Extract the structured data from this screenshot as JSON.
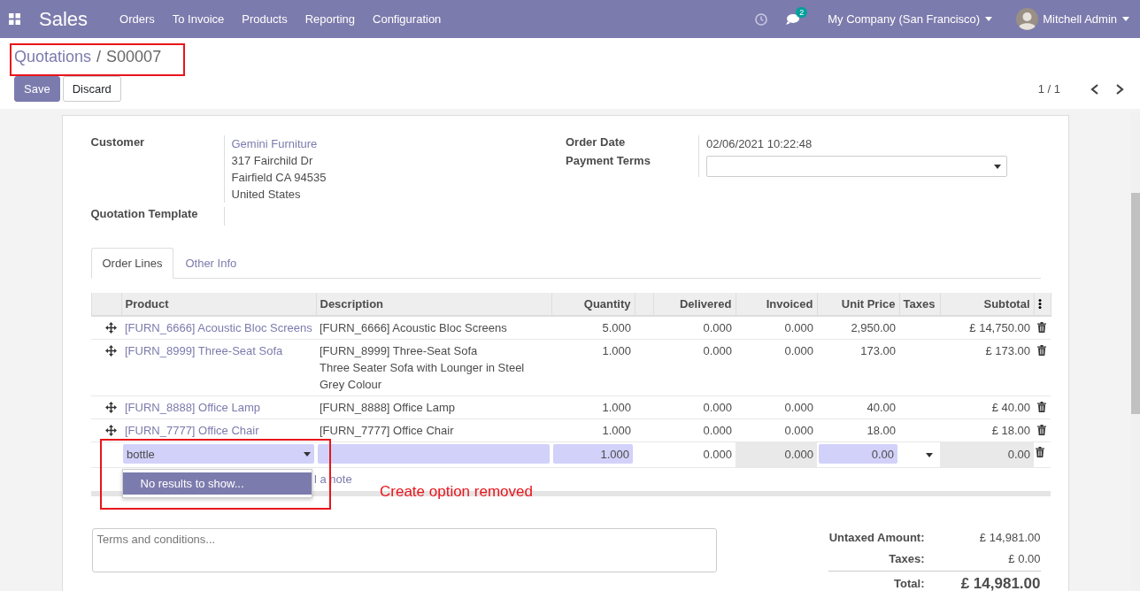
{
  "navbar": {
    "app": "Sales",
    "menu": [
      {
        "label": "Orders"
      },
      {
        "label": "To Invoice"
      },
      {
        "label": "Products"
      },
      {
        "label": "Reporting"
      },
      {
        "label": "Configuration"
      }
    ],
    "chat_count": "2",
    "company": "My Company (San Francisco)",
    "user": "Mitchell Admin"
  },
  "breadcrumb": {
    "parent": "Quotations",
    "separator": "/",
    "current": "S00007"
  },
  "buttons": [
    {
      "label": "Save",
      "kind": "primary"
    },
    {
      "label": "Discard",
      "kind": "secondary"
    }
  ],
  "pager": "1 / 1",
  "form": {
    "left": [
      {
        "label": "Customer",
        "link": "Gemini Furniture",
        "lines": [
          "317 Fairchild Dr",
          "Fairfield CA 94535",
          "United States"
        ]
      },
      {
        "label": "Quotation Template"
      }
    ],
    "right": [
      {
        "label": "Order Date",
        "value": "02/06/2021 10:22:48",
        "kind": "text"
      },
      {
        "label": "Payment Terms",
        "kind": "select"
      }
    ]
  },
  "tabs": [
    {
      "label": "Order Lines",
      "selected": true
    },
    {
      "label": "Other Info",
      "selected": false
    }
  ],
  "table": {
    "columns": [
      "Product",
      "Description",
      "Quantity",
      "Delivered",
      "Invoiced",
      "Unit Price",
      "Taxes",
      "Subtotal"
    ],
    "rows": [
      {
        "kind": "line",
        "product": "[FURN_6666] Acoustic Bloc Screens",
        "description": [
          "[FURN_6666] Acoustic Bloc Screens"
        ],
        "quantity": "5.000",
        "delivered": "0.000",
        "invoiced": "0.000",
        "unit_price": "2,950.00",
        "subtotal": "£ 14,750.00"
      },
      {
        "kind": "line",
        "product": "[FURN_8999] Three-Seat Sofa",
        "description": [
          "[FURN_8999] Three-Seat Sofa",
          "Three Seater Sofa with Lounger in Steel",
          "Grey Colour"
        ],
        "quantity": "1.000",
        "delivered": "0.000",
        "invoiced": "0.000",
        "unit_price": "173.00",
        "subtotal": "£ 173.00"
      },
      {
        "kind": "line",
        "product": "[FURN_8888] Office Lamp",
        "description": [
          "[FURN_8888] Office Lamp"
        ],
        "quantity": "1.000",
        "delivered": "0.000",
        "invoiced": "0.000",
        "unit_price": "40.00",
        "subtotal": "£ 40.00"
      },
      {
        "kind": "line",
        "product": "[FURN_7777] Office Chair",
        "description": [
          "[FURN_7777] Office Chair"
        ],
        "quantity": "1.000",
        "delivered": "0.000",
        "invoiced": "0.000",
        "unit_price": "18.00",
        "subtotal": "£ 18.00"
      },
      {
        "kind": "editing",
        "product": "bottle",
        "quantity": "1.000",
        "delivered": "0.000",
        "invoiced": "0.000",
        "unit_price": "0.00",
        "subtotal": "0.00"
      }
    ],
    "add_line_text": "l a note",
    "dropdown": {
      "items": [
        {
          "label": "No results to show...",
          "selected": true
        }
      ]
    }
  },
  "terms": {
    "placeholder": "Terms and conditions..."
  },
  "totals": [
    {
      "label": "Untaxed Amount:",
      "value": "£ 14,981.00",
      "kind": "normal"
    },
    {
      "label": "Taxes:",
      "value": "£ 0.00",
      "kind": "normal"
    },
    {
      "label": "Total:",
      "value": "£ 14,981.00",
      "kind": "grand"
    }
  ],
  "annotations": [
    {
      "kind": "frame"
    },
    {
      "kind": "frame"
    },
    {
      "kind": "note",
      "text": "Create option removed"
    }
  ]
}
